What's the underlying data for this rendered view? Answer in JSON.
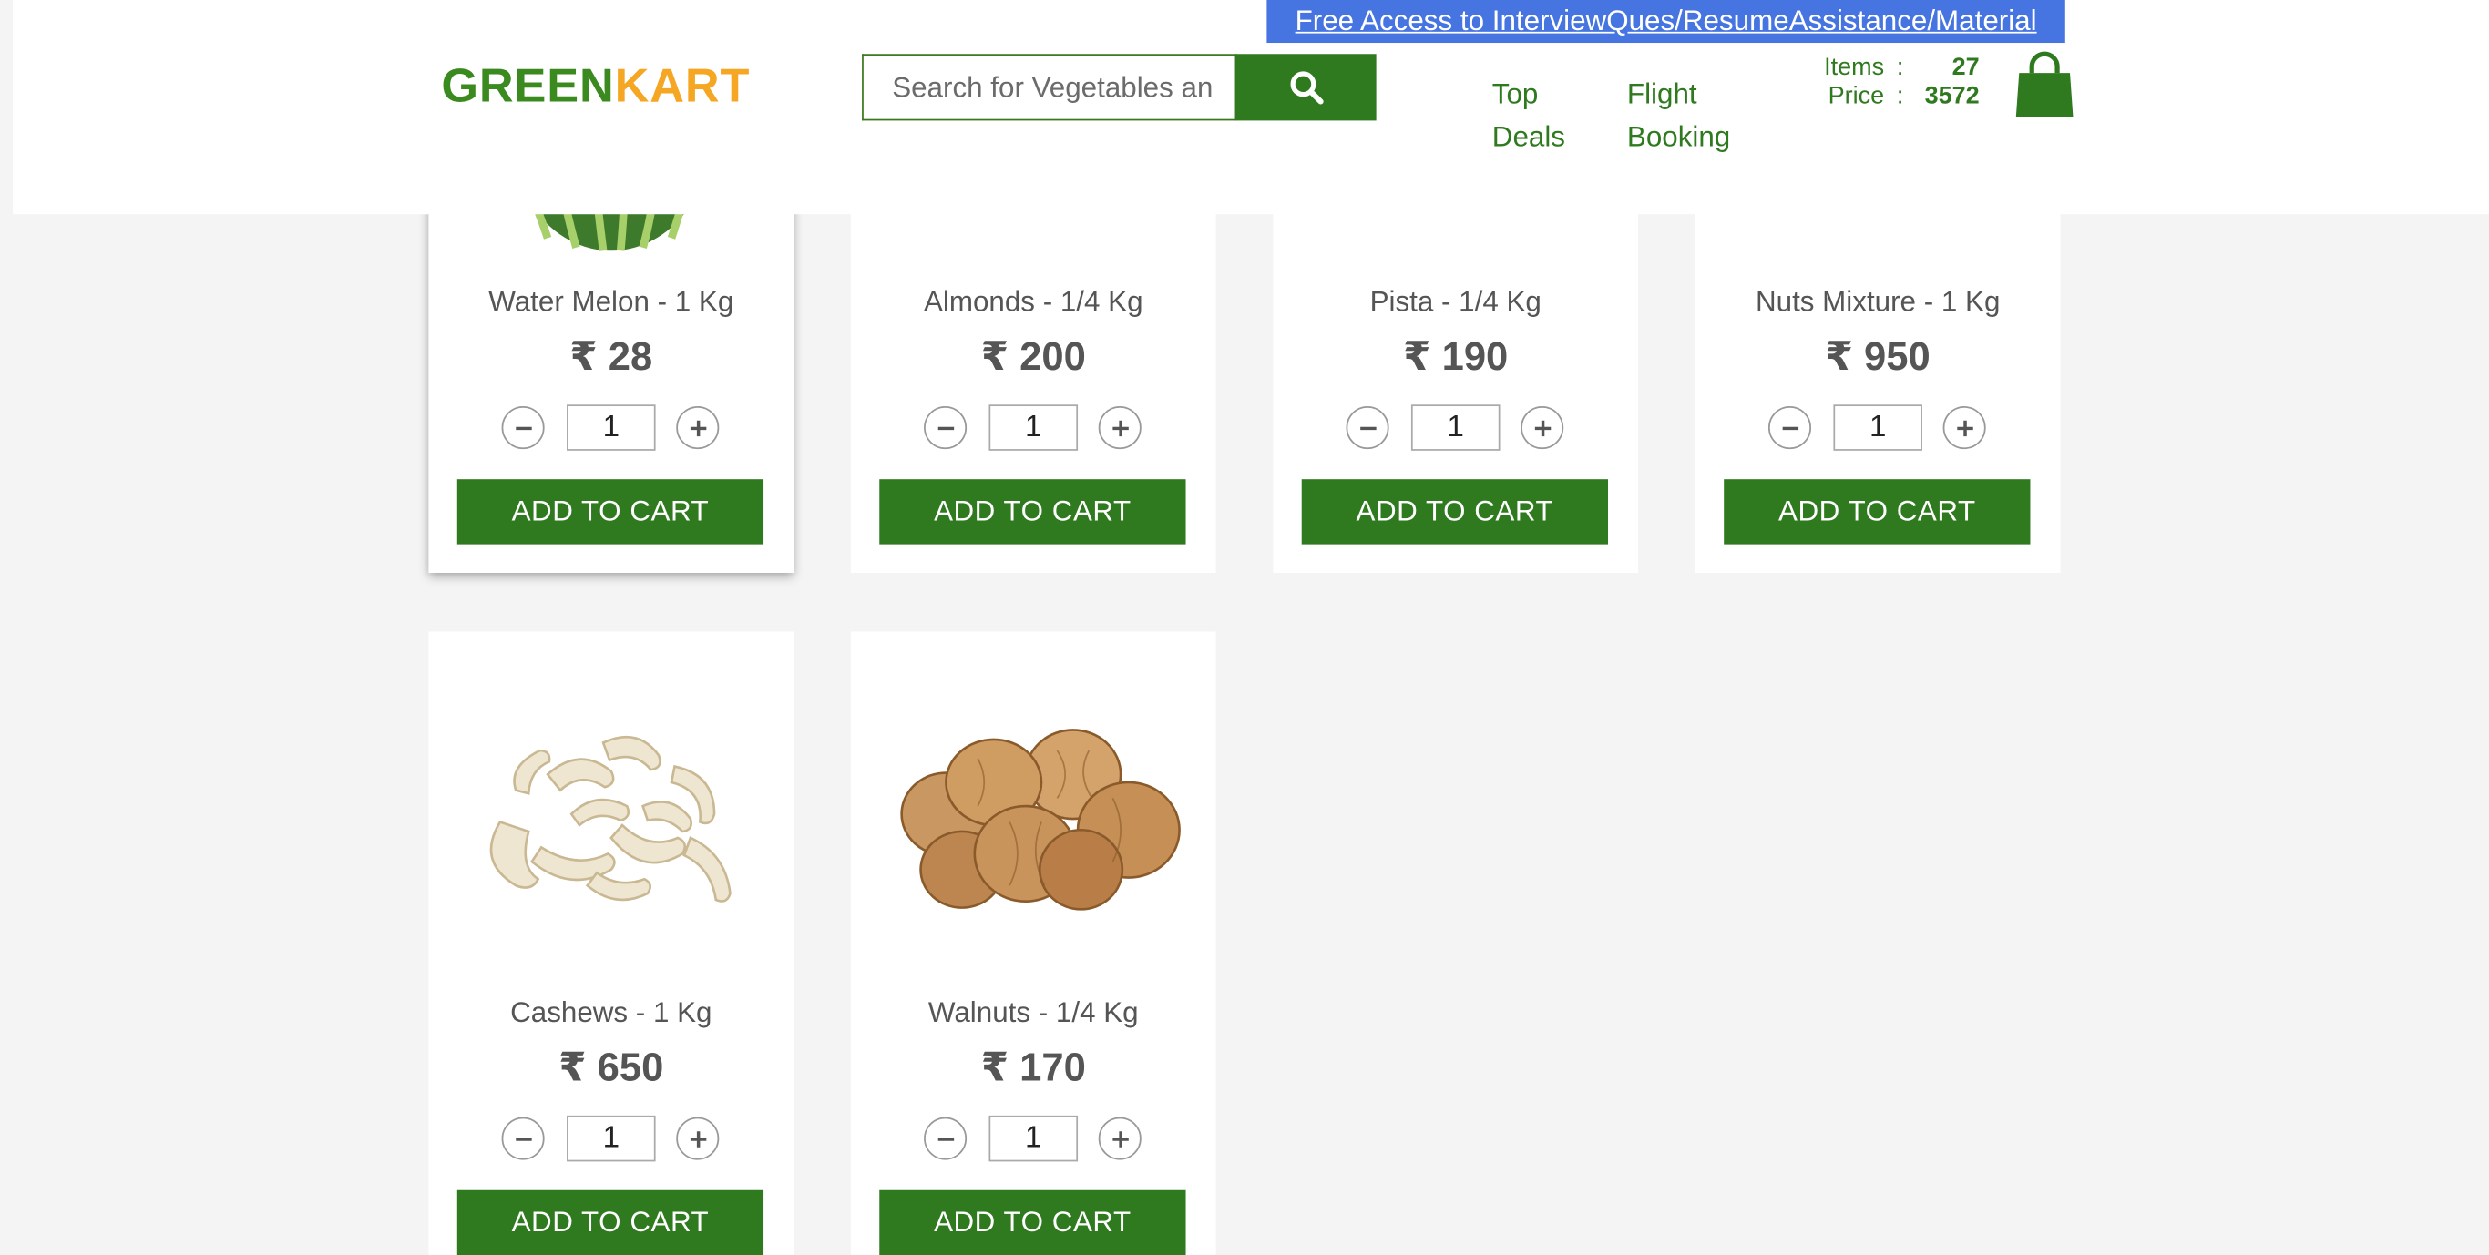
{
  "header": {
    "promo_link": "Free Access to InterviewQues/ResumeAssistance/Material",
    "logo_green": "GREEN",
    "logo_kart": "KART",
    "search_placeholder": "Search for Vegetables and Fruits",
    "nav": {
      "top": "Top",
      "deals": "Deals",
      "flight": "Flight",
      "booking": "Booking"
    },
    "cart": {
      "items_label": "Items",
      "items_value": "27",
      "price_label": "Price",
      "price_value": "3572",
      "colon": ":"
    }
  },
  "products": [
    {
      "name": "Water Melon - 1 Kg",
      "price": "₹ 28",
      "qty": "1",
      "button": "ADD TO CART"
    },
    {
      "name": "Almonds - 1/4 Kg",
      "price": "₹ 200",
      "qty": "1",
      "button": "ADD TO CART"
    },
    {
      "name": "Pista - 1/4 Kg",
      "price": "₹ 190",
      "qty": "1",
      "button": "ADD TO CART"
    },
    {
      "name": "Nuts Mixture - 1 Kg",
      "price": "₹ 950",
      "qty": "1",
      "button": "ADD TO CART"
    },
    {
      "name": "Cashews - 1 Kg",
      "price": "₹ 650",
      "qty": "1",
      "button": "ADD TO CART"
    },
    {
      "name": "Walnuts - 1/4 Kg",
      "price": "₹ 170",
      "qty": "1",
      "button": "ADD TO CART"
    }
  ],
  "colors": {
    "brand_green": "#2f7a1f",
    "logo_orange": "#f5a623",
    "promo_blue": "#4674e0"
  },
  "icons": [
    "search-icon",
    "cart-bag-icon",
    "minus-icon",
    "plus-icon"
  ]
}
